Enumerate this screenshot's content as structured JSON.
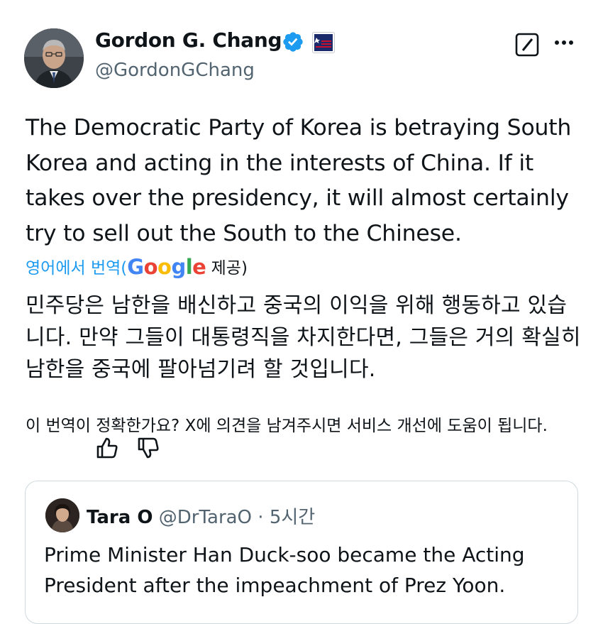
{
  "author": {
    "name": "Gordon G. Chang",
    "handle": "@GordonGChang"
  },
  "tweet": {
    "text": "The Democratic Party of Korea is betraying South Korea and acting in the interests of China. If it takes over the presidency, it will almost certainly try to sell out the South to the Chinese."
  },
  "translation": {
    "label": "영어에서 번역(",
    "provider_suffix": " 제공)",
    "text": "민주당은 남한을 배신하고 중국의 이익을 위해 행동하고 있습니다. 만약 그들이 대통령직을 차지한다면, 그들은 거의 확실히 남한을 중국에 팔아넘기려 할 것입니다.",
    "feedback_prompt": "이 번역이 정확한가요? X에 의견을 남겨주시면 서비스 개선에 도움이 됩니다."
  },
  "quoted_tweet": {
    "name": "Tara O",
    "handle": "@DrTaraO",
    "separator": " · ",
    "time": "5시간",
    "text": "Prime Minister Han Duck-soo became the Acting President after the impeachment of Prez Yoon."
  },
  "colors": {
    "link_blue": "#1d9bf0",
    "secondary_text": "#536471",
    "verified_blue": "#1d9bf0",
    "border": "#cfd9de"
  },
  "icons": [
    "verified-badge-icon",
    "cpac-affiliate-badge-icon",
    "grok-icon",
    "more-options-icon",
    "thumbs-up-icon",
    "thumbs-down-icon"
  ]
}
